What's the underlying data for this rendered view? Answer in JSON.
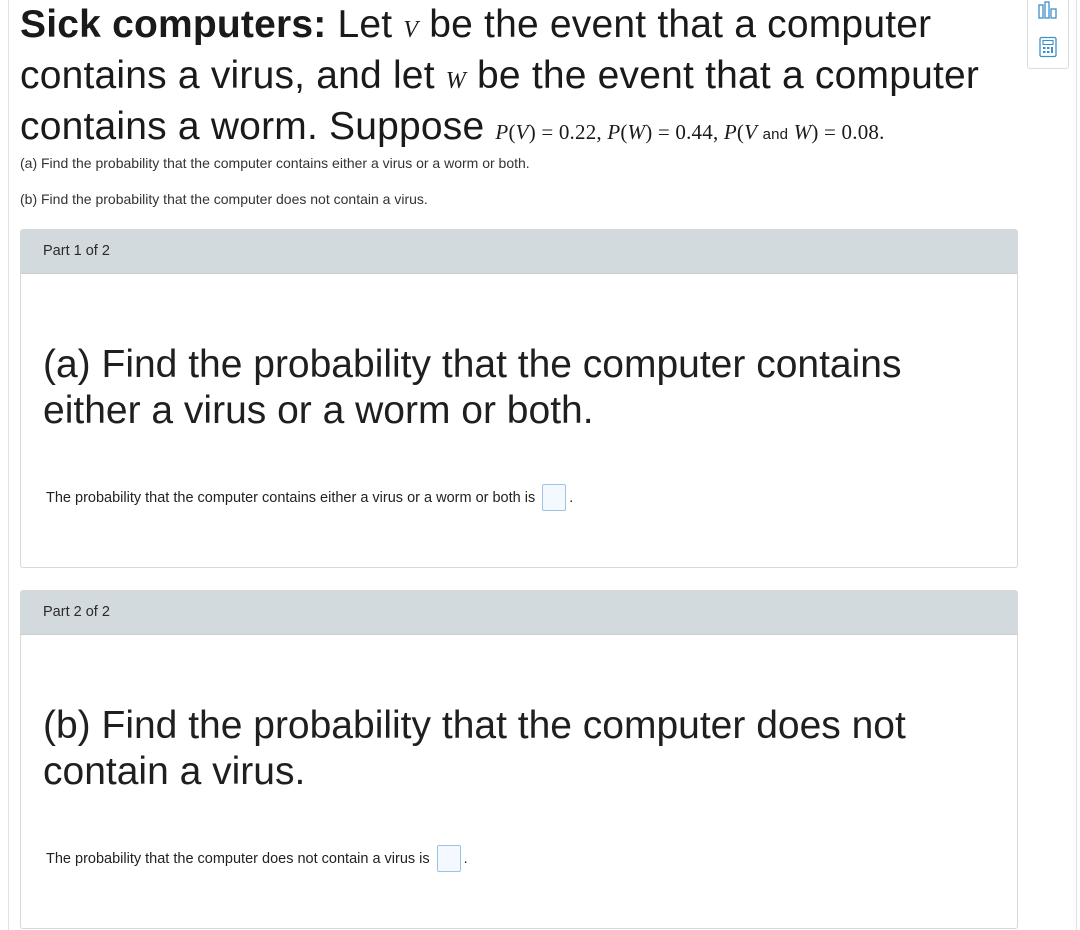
{
  "problem": {
    "title_bold": "Sick computers:",
    "title_t1": " Let ",
    "var_v": "V",
    "title_t2": " be the event that a computer contains a virus, and let ",
    "var_w": "W",
    "title_t3": " be the event that a computer contains a worm. Suppose ",
    "given": {
      "p": "P",
      "v": "V",
      "w": "W",
      "and": "and",
      "pv_value": "0.22",
      "pw_value": "0.44",
      "pvw_value": "0.08"
    },
    "question_a": "(a) Find the probability that the computer contains either a virus or a worm or both.",
    "question_b": "(b) Find the probability that the computer does not contain a virus."
  },
  "parts": [
    {
      "header": "Part 1 of 2",
      "question": "(a) Find the probability that the computer contains either a virus or a worm or both.",
      "answer_prompt": "The probability that the computer contains either a virus or a worm or both is",
      "answer_value": "",
      "period": "."
    },
    {
      "header": "Part 2 of 2",
      "question": "(b) Find the probability that the computer does not contain a virus.",
      "answer_prompt": "The probability that the computer does not contain a virus is",
      "answer_value": "",
      "period": "."
    }
  ],
  "toolbar": {
    "icons": [
      "bar-chart-icon",
      "calculator-icon"
    ],
    "accent_color": "#3f8fc9"
  }
}
